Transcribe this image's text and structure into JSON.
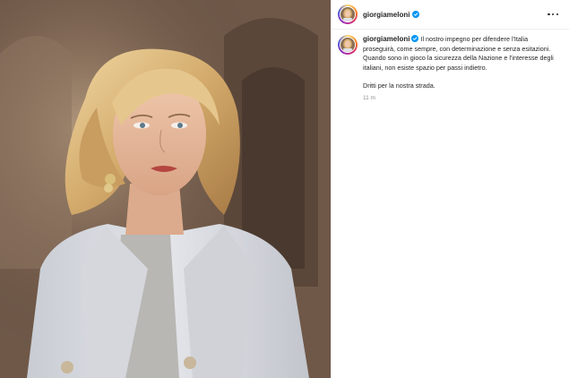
{
  "post": {
    "author": {
      "username": "giorgiameloni",
      "verified": true
    },
    "more_icon": "more-horizontal-icon",
    "verified_icon": "verified-badge-icon",
    "caption": {
      "text": "Il nostro impegno per difendere l'Italia proseguirà, come sempre, con determinazione e senza esitazioni. Quando sono in gioco la sicurezza della Nazione e l'interesse degli italiani, non esiste spazio per passi indietro.",
      "closing": "Dritti per la nostra strada."
    },
    "timestamp": "11 m"
  },
  "colors": {
    "verified_blue": "#0095f6",
    "text": "#262626",
    "muted": "#8e8e8e"
  }
}
